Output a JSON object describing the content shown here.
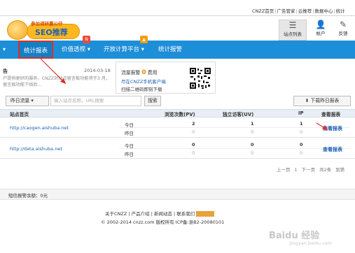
{
  "top_links": [
    "CNZZ首页",
    "广告管家",
    "云推荐",
    "数据中心",
    "统计"
  ],
  "logo": {
    "line1": "参加调研赢公仔",
    "line2": "SEO推荐"
  },
  "top_icons": [
    {
      "label": "站点列表",
      "icon": "list-icon",
      "glyph": "☰"
    },
    {
      "label": "帐户",
      "icon": "user-icon",
      "glyph": "👤"
    },
    {
      "label": "反馈",
      "icon": "feedback-icon",
      "glyph": "✎"
    }
  ],
  "nav": {
    "menu_glyph": "▾",
    "items": [
      "统计报表",
      "价值透视 ▾",
      "开放计算平台 ▾",
      "统计报警"
    ],
    "badges": [
      "N",
      "▲"
    ]
  },
  "notice": {
    "title": "告",
    "date": "2014-03-18",
    "text": "户提供更好的服务，CNZZ对站点留言板功能将于3 月，留言板功能下线后..."
  },
  "qr_panel": {
    "line1_prefix": "流量报警",
    "line1_count": "0",
    "line1_suffix": "费用",
    "line2": "尽在CNZZ手机客户端",
    "line3": "扫描二维码即刻下载"
  },
  "toolbar": {
    "select_value": "昨日流量 ▾",
    "search_placeholder": "输入站点名称，URL搜索",
    "search_label": "搜索",
    "download_label": "⬇ 下载昨日报表"
  },
  "table": {
    "headers": [
      "站点首页",
      "浏览次数(PV)",
      "独立访客(UV)",
      "IP",
      "查看报表"
    ],
    "rows": [
      {
        "site": "http://caogen.aishuba.net",
        "label_today": "今日",
        "label_yesterday": "昨日",
        "today": [
          "2",
          "1",
          "1"
        ],
        "yesterday": [
          "0",
          "0",
          "0"
        ],
        "report": "查看报表"
      },
      {
        "site": "http://data.aishuba.net",
        "label_today": "今日",
        "label_yesterday": "昨日",
        "today": [
          "0",
          "0",
          "0"
        ],
        "yesterday": [
          "0",
          "0",
          "0"
        ],
        "report": "查看报表"
      }
    ]
  },
  "pager": [
    "上一页",
    "1",
    "下一页",
    "共2条",
    "到第"
  ],
  "sms": "短信报警余额：0元",
  "footer": {
    "links": "关于CNZZ | 产品介绍 | 新闻动态 | 联系我们",
    "copyright": "© 2002-2014 cnzz.com 版权所有 ICP备:浙B2-20080101"
  },
  "watermark": {
    "logo": "Baidu 经验",
    "url": "jingyan.baidu.com"
  },
  "colors": {
    "nav_blue": "#1d8ed8",
    "highlight_red": "#d9302a",
    "link_blue": "#1a5fb4"
  }
}
